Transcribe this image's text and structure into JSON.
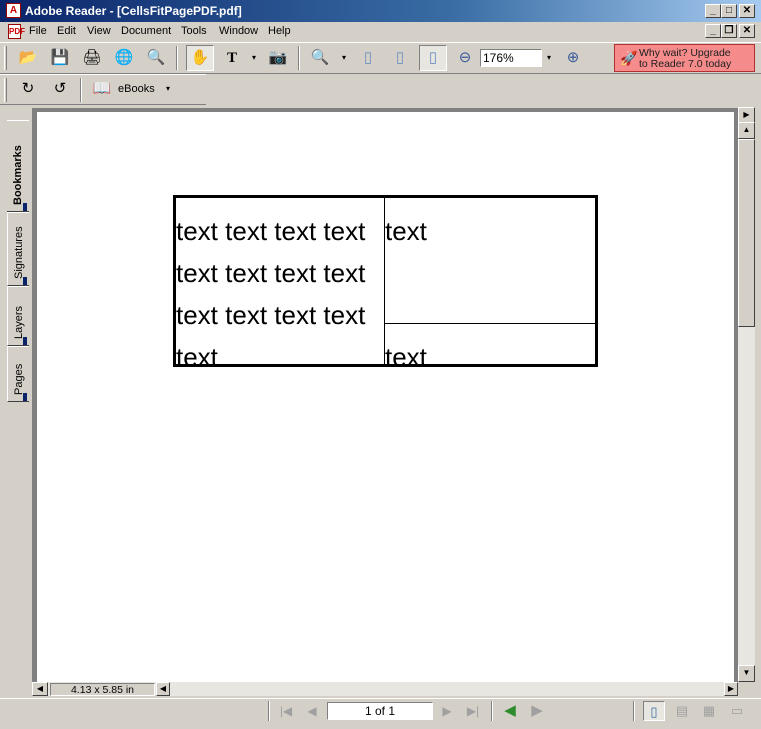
{
  "window": {
    "title": "Adobe Reader - [CellsFitPagePDF.pdf]",
    "app_icon_glyph": "A",
    "controls": {
      "minimize": "_",
      "maximize": "□",
      "close": "✕"
    },
    "mdi_controls": {
      "minimize": "_",
      "restore": "❐",
      "close": "✕"
    }
  },
  "menu": {
    "doc_icon_glyph": "PDF",
    "items": [
      "File",
      "Edit",
      "View",
      "Document",
      "Tools",
      "Window",
      "Help"
    ]
  },
  "toolbar": {
    "open_icon": "📂",
    "save_icon": "💾",
    "print_icon": "🖨",
    "email_icon": "🌐",
    "search_icon": "🔍",
    "hand_icon": "✋",
    "select_text_icon": "T",
    "snapshot_icon": "📷",
    "zoom_in_tool_icon": "🔍",
    "actual_size_icon": "▯",
    "fit_page_icon": "▯",
    "fit_width_icon": "▯",
    "zoom_out_icon": "⊖",
    "zoom_value": "176%",
    "zoom_in_icon": "⊕",
    "dropdown": "▾"
  },
  "upgrade_banner": {
    "line1": "Why wait? Upgrade",
    "line2": "to Reader 7.0 today",
    "icon": "🚀"
  },
  "toolbar2": {
    "rotate_cw_icon": "↻",
    "rotate_ccw_icon": "↺",
    "ebooks_icon": "📖",
    "ebooks_label": "eBooks",
    "dropdown": "▾"
  },
  "side_tabs": [
    "Bookmarks",
    "Signatures",
    "Layers",
    "Pages"
  ],
  "document": {
    "table": {
      "rows": [
        [
          "text text text text\ntext text text text\ntext text text text",
          "text"
        ],
        [
          "text",
          "text"
        ]
      ]
    }
  },
  "scrollbars": {
    "up": "▲",
    "down": "▼",
    "left": "◀",
    "right": "▶",
    "expand": "▶"
  },
  "page_size_label": "4.13 x 5.85 in",
  "navigation": {
    "first": "|◀",
    "prev": "◀",
    "page_indicator": "1 of 1",
    "next": "▶",
    "last": "▶|",
    "back": "◀",
    "forward": "▶"
  },
  "layout_buttons": [
    "single-page",
    "continuous",
    "continuous-facing",
    "facing"
  ]
}
